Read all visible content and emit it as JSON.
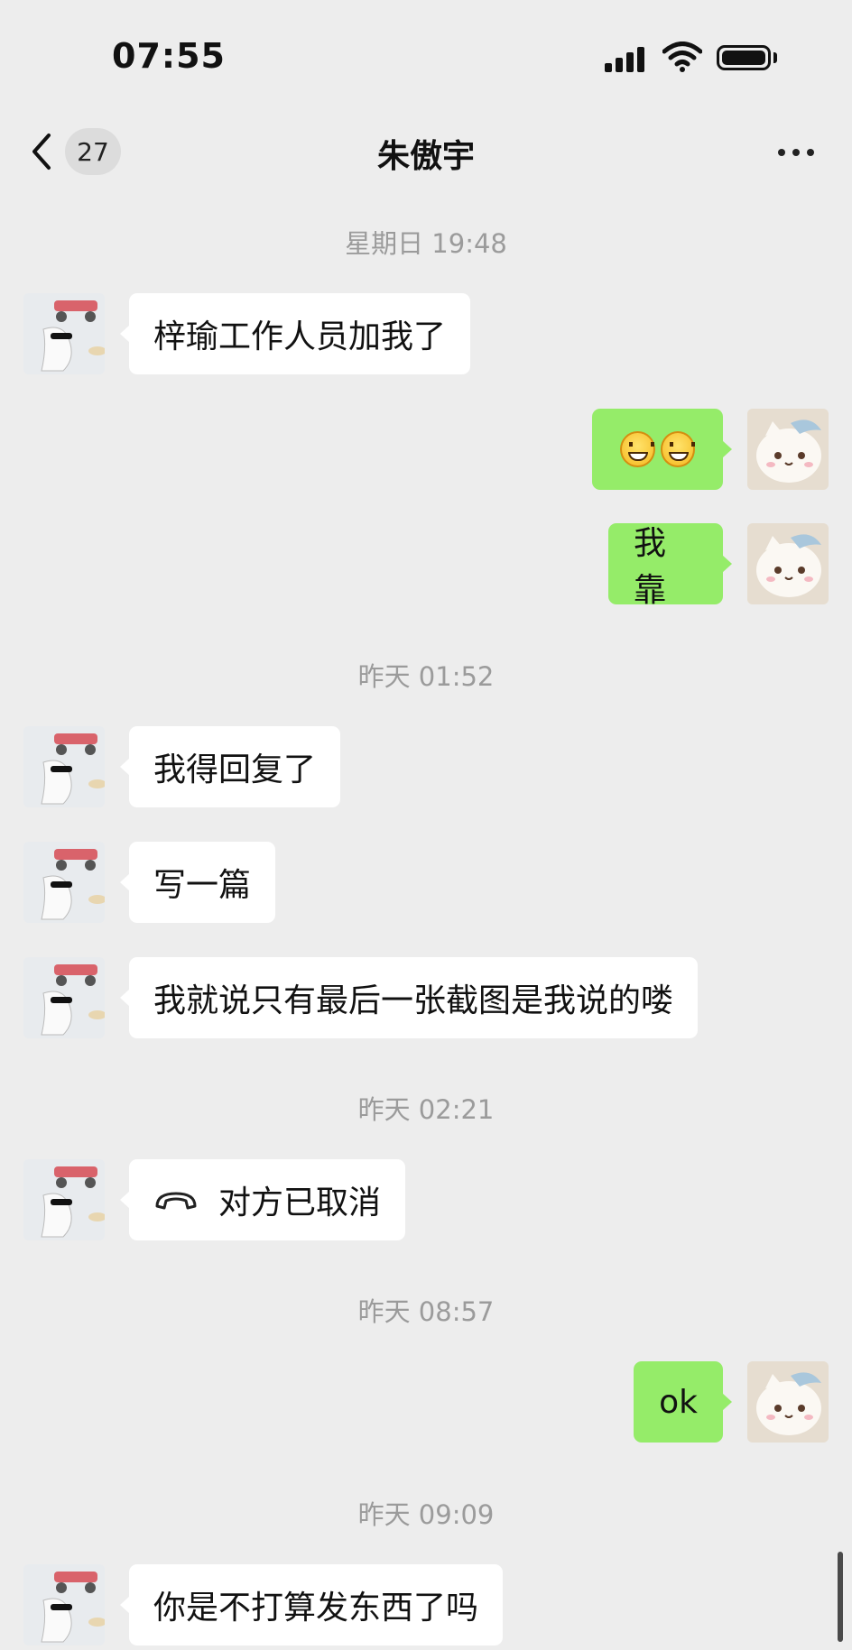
{
  "status_bar": {
    "time": "07:55",
    "icons": [
      "cellular-signal-icon",
      "wifi-icon",
      "battery-icon"
    ]
  },
  "nav": {
    "back_icon": "chevron-left-icon",
    "unread_count": "27",
    "title": "朱傲宇",
    "more_icon": "more-dots-icon"
  },
  "colors": {
    "background": "#ededed",
    "incoming_bubble": "#ffffff",
    "outgoing_bubble": "#95ec69",
    "timestamp": "#9b9b9b"
  },
  "chat": {
    "timestamps": [
      "星期日 19:48",
      "昨天 01:52",
      "昨天 02:21",
      "昨天 08:57",
      "昨天 09:09"
    ],
    "messages": [
      {
        "side": "left",
        "text": "梓瑜工作人员加我了"
      },
      {
        "side": "right",
        "type": "emoji",
        "emoji": [
          "grinning-face-emoji",
          "grinning-face-emoji"
        ]
      },
      {
        "side": "right",
        "text": "我靠"
      },
      {
        "side": "left",
        "text": "我得回复了"
      },
      {
        "side": "left",
        "text": "写一篇"
      },
      {
        "side": "left",
        "text": "我就说只有最后一张截图是我说的喽"
      },
      {
        "side": "left",
        "type": "call",
        "icon": "hangup-phone-icon",
        "text": "对方已取消"
      },
      {
        "side": "right",
        "text": "ok"
      },
      {
        "side": "left",
        "text": "你是不打算发东西了吗"
      }
    ]
  }
}
